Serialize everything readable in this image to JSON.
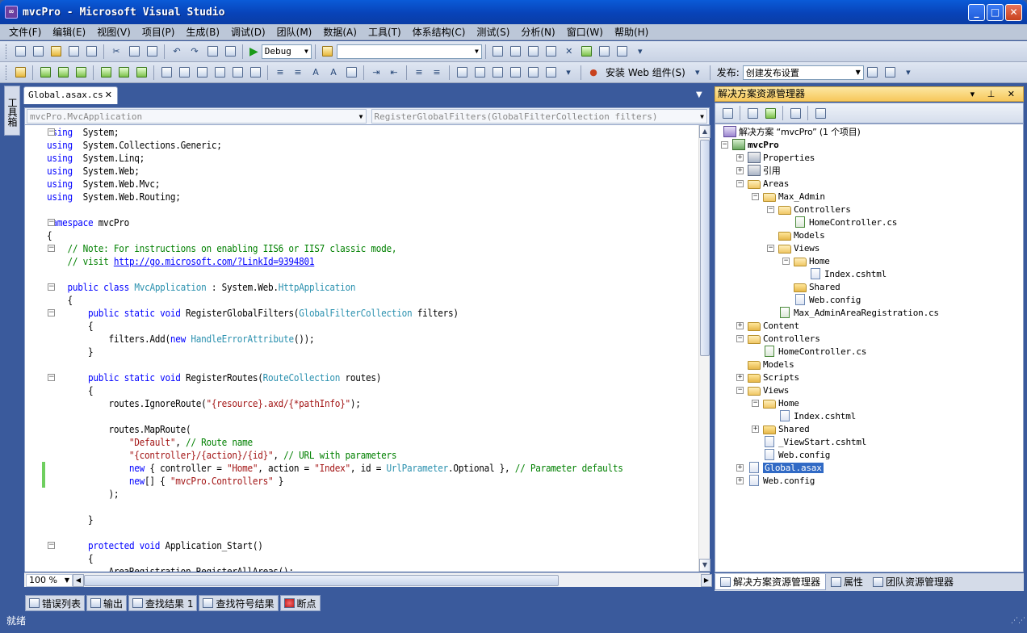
{
  "window": {
    "title": "mvcPro - Microsoft Visual Studio",
    "app_icon": "vs-icon"
  },
  "menu": [
    "文件(F)",
    "编辑(E)",
    "视图(V)",
    "项目(P)",
    "生成(B)",
    "调试(D)",
    "团队(M)",
    "数据(A)",
    "工具(T)",
    "体系结构(C)",
    "测试(S)",
    "分析(N)",
    "窗口(W)",
    "帮助(H)"
  ],
  "toolbar": {
    "config": "Debug",
    "search_value": "",
    "install_label": "安装 Web 组件(S)",
    "publish_label": "发布:",
    "publish_config": "创建发布设置"
  },
  "toolbox": {
    "label": "工具箱"
  },
  "editor": {
    "tab_name": "Global.asax.cs",
    "tab_close": "✕",
    "nav_class": "mvcPro.MvcApplication",
    "nav_member": "RegisterGlobalFilters(GlobalFilterCollection filters)",
    "zoom": "100 %",
    "lines": [
      {
        "fold": "-",
        "parts": [
          [
            "kw",
            "using"
          ],
          [
            "",
            "  System;"
          ]
        ]
      },
      {
        "parts": [
          [
            "kw",
            "using"
          ],
          [
            "",
            "  System.Collections.Generic;"
          ]
        ]
      },
      {
        "parts": [
          [
            "kw",
            "using"
          ],
          [
            "",
            "  System.Linq;"
          ]
        ]
      },
      {
        "parts": [
          [
            "kw",
            "using"
          ],
          [
            "",
            "  System.Web;"
          ]
        ]
      },
      {
        "parts": [
          [
            "kw",
            "using"
          ],
          [
            "",
            "  System.Web.Mvc;"
          ]
        ]
      },
      {
        "parts": [
          [
            "kw",
            "using"
          ],
          [
            "",
            "  System.Web.Routing;"
          ]
        ]
      },
      {
        "parts": []
      },
      {
        "fold": "-",
        "parts": [
          [
            "kw",
            "namespace"
          ],
          [
            "",
            " mvcPro"
          ]
        ]
      },
      {
        "parts": [
          [
            "",
            "{"
          ]
        ]
      },
      {
        "fold": "-",
        "parts": [
          [
            "cm",
            "    // Note: For instructions on enabling IIS6 or IIS7 classic mode,"
          ]
        ]
      },
      {
        "parts": [
          [
            "cm",
            "    // visit "
          ],
          [
            "lk",
            "http://go.microsoft.com/?LinkId=9394801"
          ]
        ]
      },
      {
        "parts": []
      },
      {
        "fold": "-",
        "parts": [
          [
            "",
            "    "
          ],
          [
            "kw",
            "public class"
          ],
          [
            "",
            " "
          ],
          [
            "ty",
            "MvcApplication"
          ],
          [
            "",
            " : System.Web."
          ],
          [
            "ty",
            "HttpApplication"
          ]
        ]
      },
      {
        "parts": [
          [
            "",
            "    {"
          ]
        ]
      },
      {
        "fold": "-",
        "parts": [
          [
            "",
            "        "
          ],
          [
            "kw",
            "public static void"
          ],
          [
            "",
            " RegisterGlobalFilters("
          ],
          [
            "ty",
            "GlobalFilterCollection"
          ],
          [
            "",
            " filters)"
          ]
        ]
      },
      {
        "parts": [
          [
            "",
            "        {"
          ]
        ]
      },
      {
        "parts": [
          [
            "",
            "            filters.Add("
          ],
          [
            "kw",
            "new"
          ],
          [
            "",
            " "
          ],
          [
            "ty",
            "HandleErrorAttribute"
          ],
          [
            "",
            "());"
          ]
        ]
      },
      {
        "parts": [
          [
            "",
            "        }"
          ]
        ]
      },
      {
        "parts": []
      },
      {
        "fold": "-",
        "parts": [
          [
            "",
            "        "
          ],
          [
            "kw",
            "public static void"
          ],
          [
            "",
            " RegisterRoutes("
          ],
          [
            "ty",
            "RouteCollection"
          ],
          [
            "",
            " routes)"
          ]
        ]
      },
      {
        "parts": [
          [
            "",
            "        {"
          ]
        ]
      },
      {
        "parts": [
          [
            "",
            "            routes.IgnoreRoute("
          ],
          [
            "st",
            "\"{resource}.axd/{*pathInfo}\""
          ],
          [
            "",
            ");"
          ]
        ]
      },
      {
        "parts": []
      },
      {
        "parts": [
          [
            "",
            "            routes.MapRoute("
          ]
        ]
      },
      {
        "parts": [
          [
            "",
            "                "
          ],
          [
            "st",
            "\"Default\""
          ],
          [
            "",
            ", "
          ],
          [
            "cm",
            "// Route name"
          ]
        ]
      },
      {
        "parts": [
          [
            "",
            "                "
          ],
          [
            "st",
            "\"{controller}/{action}/{id}\""
          ],
          [
            "",
            ", "
          ],
          [
            "cm",
            "// URL with parameters"
          ]
        ]
      },
      {
        "change": true,
        "parts": [
          [
            "",
            "                "
          ],
          [
            "kw",
            "new"
          ],
          [
            "",
            " { controller = "
          ],
          [
            "st",
            "\"Home\""
          ],
          [
            "",
            ", action = "
          ],
          [
            "st",
            "\"Index\""
          ],
          [
            "",
            ", id = "
          ],
          [
            "ty",
            "UrlParameter"
          ],
          [
            "",
            ".Optional }, "
          ],
          [
            "cm",
            "// Parameter defaults"
          ]
        ]
      },
      {
        "change": true,
        "parts": [
          [
            "",
            "                "
          ],
          [
            "kw",
            "new"
          ],
          [
            "",
            "[] { "
          ],
          [
            "st",
            "\"mvcPro.Controllers\""
          ],
          [
            "",
            " }"
          ]
        ]
      },
      {
        "parts": [
          [
            "",
            "            );"
          ]
        ]
      },
      {
        "parts": []
      },
      {
        "parts": [
          [
            "",
            "        }"
          ]
        ]
      },
      {
        "parts": []
      },
      {
        "fold": "-",
        "parts": [
          [
            "",
            "        "
          ],
          [
            "kw",
            "protected void"
          ],
          [
            "",
            " Application_Start()"
          ]
        ]
      },
      {
        "parts": [
          [
            "",
            "        {"
          ]
        ]
      },
      {
        "parts": [
          [
            "",
            "            AreaRegistration.RegisterAllAreas();"
          ]
        ]
      }
    ]
  },
  "solution_explorer": {
    "title": "解决方案资源管理器",
    "header_controls": "▾ ⊥ ✕",
    "tree": [
      {
        "d": 0,
        "e": "",
        "i": "sln",
        "t": "解决方案 “mvcPro” (1 个项目)"
      },
      {
        "d": 0,
        "e": "-",
        "i": "proj",
        "t": "mvcPro",
        "b": true
      },
      {
        "d": 1,
        "e": "+",
        "i": "ref",
        "t": "Properties"
      },
      {
        "d": 1,
        "e": "+",
        "i": "ref",
        "t": "引用"
      },
      {
        "d": 1,
        "e": "-",
        "i": "folder open",
        "t": "Areas"
      },
      {
        "d": 2,
        "e": "-",
        "i": "folder open",
        "t": "Max_Admin"
      },
      {
        "d": 3,
        "e": "-",
        "i": "folder open",
        "t": "Controllers"
      },
      {
        "d": 4,
        "e": "",
        "i": "file cs",
        "t": "HomeController.cs"
      },
      {
        "d": 3,
        "e": "",
        "i": "folder",
        "t": "Models"
      },
      {
        "d": 3,
        "e": "-",
        "i": "folder open",
        "t": "Views"
      },
      {
        "d": 4,
        "e": "-",
        "i": "folder open",
        "t": "Home"
      },
      {
        "d": 5,
        "e": "",
        "i": "file cfg",
        "t": "Index.cshtml"
      },
      {
        "d": 4,
        "e": "",
        "i": "folder",
        "t": "Shared"
      },
      {
        "d": 4,
        "e": "",
        "i": "file cfg",
        "t": "Web.config"
      },
      {
        "d": 3,
        "e": "",
        "i": "file cs",
        "t": "Max_AdminAreaRegistration.cs"
      },
      {
        "d": 1,
        "e": "+",
        "i": "folder",
        "t": "Content"
      },
      {
        "d": 1,
        "e": "-",
        "i": "folder open",
        "t": "Controllers"
      },
      {
        "d": 2,
        "e": "",
        "i": "file cs",
        "t": "HomeController.cs"
      },
      {
        "d": 1,
        "e": "",
        "i": "folder",
        "t": "Models"
      },
      {
        "d": 1,
        "e": "+",
        "i": "folder",
        "t": "Scripts"
      },
      {
        "d": 1,
        "e": "-",
        "i": "folder open",
        "t": "Views"
      },
      {
        "d": 2,
        "e": "-",
        "i": "folder open",
        "t": "Home"
      },
      {
        "d": 3,
        "e": "",
        "i": "file cfg",
        "t": "Index.cshtml"
      },
      {
        "d": 2,
        "e": "+",
        "i": "folder",
        "t": "Shared"
      },
      {
        "d": 2,
        "e": "",
        "i": "file cfg",
        "t": "_ViewStart.cshtml"
      },
      {
        "d": 2,
        "e": "",
        "i": "file cfg",
        "t": "Web.config"
      },
      {
        "d": 1,
        "e": "+",
        "i": "file cfg",
        "t": "Global.asax",
        "sel": true
      },
      {
        "d": 1,
        "e": "+",
        "i": "file cfg",
        "t": "Web.config"
      }
    ],
    "tabs": [
      "解决方案资源管理器",
      "属性",
      "团队资源管理器"
    ]
  },
  "bottom_tabs": [
    "错误列表",
    "输出",
    "查找结果 1",
    "查找符号结果",
    "断点"
  ],
  "status": "就绪"
}
